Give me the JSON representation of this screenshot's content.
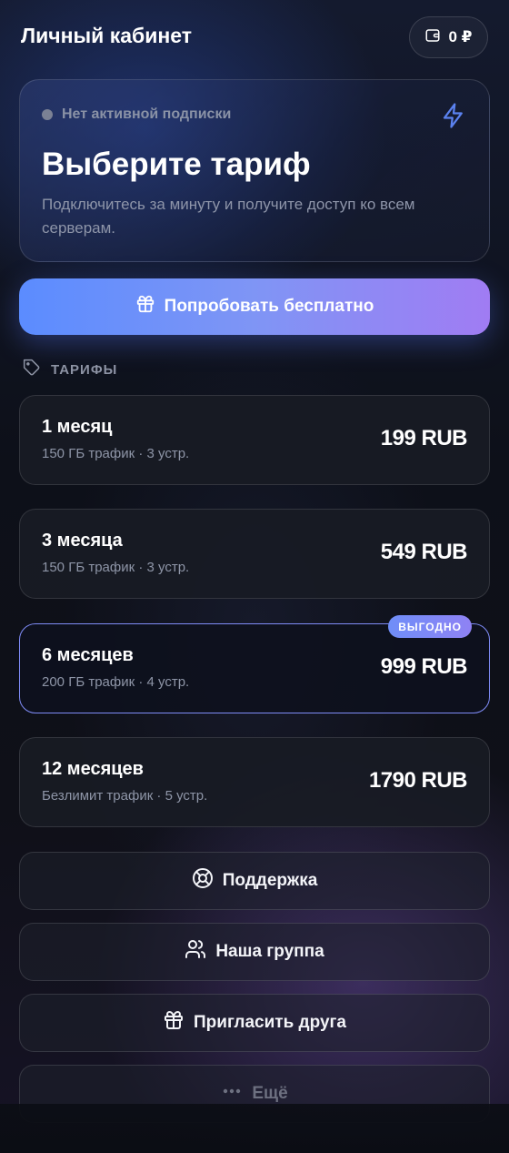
{
  "header": {
    "title": "Личный кабинет",
    "balance": "0 ₽",
    "balance_icon": "wallet-icon"
  },
  "status_card": {
    "status_text": "Нет активной подписки",
    "status_icon": "bolt-icon",
    "title": "Выберите тариф",
    "subtitle": "Подключитесь за минуту и получите доступ ко всем серверам."
  },
  "trial_button": {
    "label": "Попробовать бесплатно",
    "icon": "gift-icon"
  },
  "plans_section": {
    "label": "ТАРИФЫ",
    "icon": "tag-icon"
  },
  "plans": [
    {
      "name": "1 месяц",
      "desc": "150 ГБ трафик · 3 устр.",
      "price": "199 RUB",
      "badge": ""
    },
    {
      "name": "3 месяца",
      "desc": "150 ГБ трафик · 3 устр.",
      "price": "549 RUB",
      "badge": ""
    },
    {
      "name": "6 месяцев",
      "desc": "200 ГБ трафик · 4 устр.",
      "price": "999 RUB",
      "badge": "ВЫГОДНО"
    },
    {
      "name": "12 месяцев",
      "desc": "Безлимит трафик · 5 устр.",
      "price": "1790 RUB",
      "badge": ""
    }
  ],
  "actions": [
    {
      "label": "Поддержка",
      "icon": "lifebuoy-icon"
    },
    {
      "label": "Наша группа",
      "icon": "users-icon"
    },
    {
      "label": "Пригласить друга",
      "icon": "gift-icon"
    },
    {
      "label": "Ещё",
      "icon": "more-dots-icon"
    }
  ],
  "colors": {
    "accent_start": "#5b8cff",
    "accent_end": "#a07cf3",
    "featured_border": "#7f8cf7",
    "status_dot": "#7b8194"
  }
}
